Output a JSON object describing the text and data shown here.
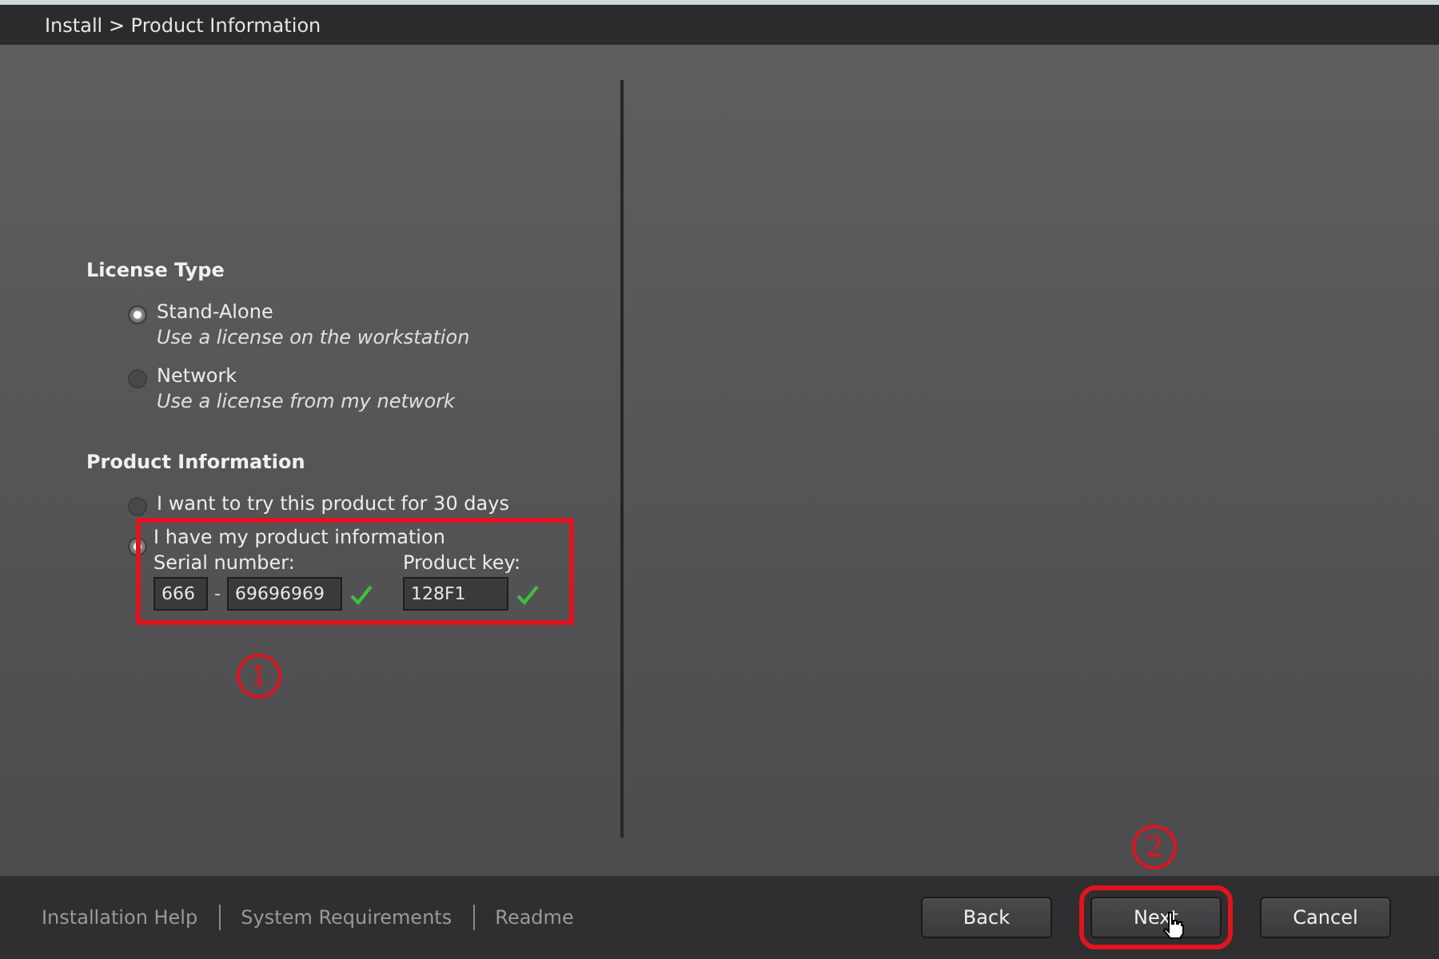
{
  "window": {
    "breadcrumb": "Install > Product Information"
  },
  "license_type": {
    "heading": "License Type",
    "options": [
      {
        "label": "Stand-Alone",
        "description": "Use a license on the workstation",
        "selected": true
      },
      {
        "label": "Network",
        "description": "Use a license from my network",
        "selected": false
      }
    ]
  },
  "product_information": {
    "heading": "Product Information",
    "options": [
      {
        "label": "I want to try this product for 30 days",
        "selected": false
      },
      {
        "label": "I have my product information",
        "selected": true
      }
    ],
    "serial_label": "Serial number:",
    "serial_prefix": "666",
    "serial_separator": "-",
    "serial_number": "69696969",
    "serial_valid": true,
    "key_label": "Product key:",
    "product_key": "128F1",
    "key_valid": true
  },
  "annotations": [
    {
      "number": "1"
    },
    {
      "number": "2"
    }
  ],
  "footer": {
    "links": [
      "Installation Help",
      "System Requirements",
      "Readme"
    ],
    "buttons": [
      {
        "label": "Back",
        "highlighted": false
      },
      {
        "label": "Next",
        "highlighted": true
      },
      {
        "label": "Cancel",
        "highlighted": false
      }
    ]
  }
}
